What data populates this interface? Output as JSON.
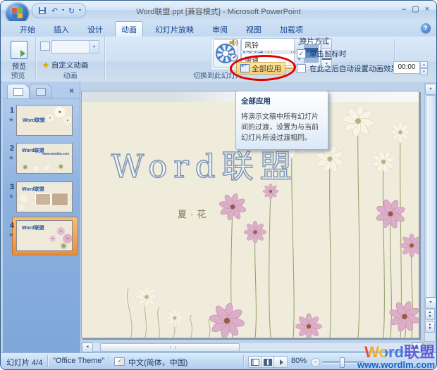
{
  "palette": {
    "highlight_red": "#e30000",
    "selection_orange": "#f0a43c",
    "watermark_red": "#e8401c",
    "watermark_orange": "#f6a21d",
    "watermark_blue": "#3f6fd8",
    "url_blue": "#1464c8"
  },
  "icons": {
    "office_logo": "office-orb",
    "save": "floppy-disk",
    "undo": "↶",
    "redo": "↻",
    "dropdown_caret": "▾",
    "minimize": "–",
    "maximize": "▢",
    "close": "×",
    "help": "?",
    "panel_close": "×",
    "animation_star": "★",
    "gallery_up": "▲",
    "gallery_down": "▼",
    "gallery_more": "▼",
    "checkbox_check": "✓",
    "spin_up": "▲",
    "spin_down": "▼",
    "scroll_up": "▲",
    "scroll_down": "▼",
    "scroll_left": "◄",
    "scroll_right": "►",
    "double_up": "▲",
    "double_down": "▼",
    "spell_check": "✓"
  },
  "window": {
    "title": "Word联盟.ppt [兼容模式] - Microsoft PowerPoint"
  },
  "tabs": {
    "items": [
      "开始",
      "插入",
      "设计",
      "动画",
      "幻灯片放映",
      "审阅",
      "视图",
      "加载项"
    ],
    "active_index": 3
  },
  "ribbon": {
    "preview_group": {
      "label": "预览",
      "preview_button": "预览"
    },
    "animation_group": {
      "label": "动画",
      "animate_value": "",
      "custom_animation": "自定义动画"
    },
    "transition_group": {
      "label": "切换到此幻灯片",
      "gallery": [
        {
          "icon": "wheel",
          "selected": false
        },
        {
          "icon": "newsflash",
          "selected": false
        },
        {
          "icon": "split",
          "selected": true
        },
        {
          "icon": "wipe",
          "selected": false
        }
      ],
      "sound_value": "风铃",
      "speed_value": "慢速",
      "apply_all_label": "全部应用",
      "advance_title": "换片方式",
      "on_click_label": "单击鼠标时",
      "on_click_checked": true,
      "auto_label": "在此之后自动设置动画效果:",
      "auto_checked": false,
      "auto_time": "00:00"
    }
  },
  "tooltip": {
    "title": "全部应用",
    "body": "将演示文稿中所有幻灯片间的过渡，设置为与当前幻灯片所设过渡相同。"
  },
  "slides_panel": {
    "slides": [
      {
        "num": "1",
        "title": "Word联盟",
        "variant": 1,
        "selected": false
      },
      {
        "num": "2",
        "title": "Word联盟",
        "url": "www.wordlm.com",
        "variant": 2,
        "selected": false
      },
      {
        "num": "3",
        "title": "Word联盟",
        "variant": 3,
        "selected": false
      },
      {
        "num": "4",
        "title": "Word联盟",
        "variant": 4,
        "selected": true
      }
    ]
  },
  "slide": {
    "title": "Word联盟",
    "caption": "夏·花"
  },
  "status_bar": {
    "slide_indicator": "幻灯片 4/4",
    "theme": "\"Office Theme\"",
    "language": "中文(简体，中国)",
    "zoom_level": "80%"
  },
  "watermark": {
    "title": "Word联盟",
    "url": "www.wordlm.com"
  }
}
